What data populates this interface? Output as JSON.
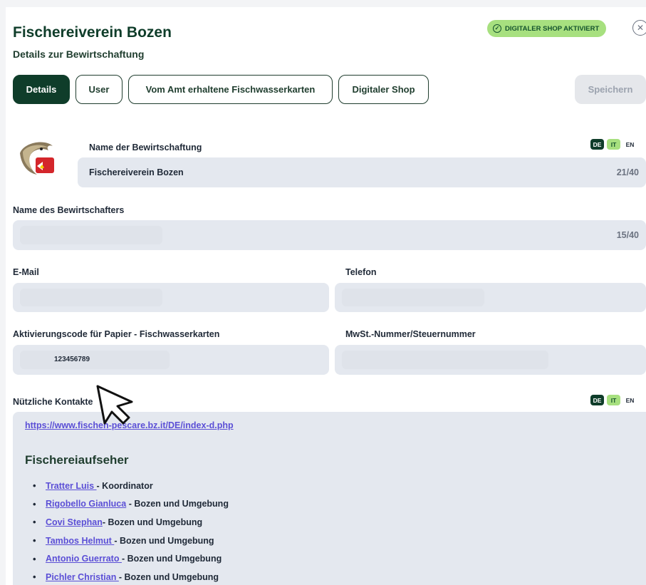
{
  "header": {
    "title": "Fischereiverein Bozen",
    "subtitle": "Details zur Bewirtschaftung",
    "shop_badge": "DIGITALER SHOP AKTIVIERT",
    "close_symbol": "✕"
  },
  "tabs": [
    {
      "label": "Details",
      "active": true
    },
    {
      "label": "User",
      "active": false
    },
    {
      "label": "Vom Amt erhaltene Fischwasserkarten",
      "active": false
    },
    {
      "label": "Digitaler Shop",
      "active": false
    }
  ],
  "save_label": "Speichern",
  "form": {
    "bewirtschaftung": {
      "label": "Name der Bewirtschaftung",
      "value": "Fischereiverein Bozen",
      "counter": "21/40"
    },
    "bewirtschafter": {
      "label": "Name des Bewirtschafters",
      "value": "",
      "counter": "15/40"
    },
    "email": {
      "label": "E-Mail",
      "value": ""
    },
    "telefon": {
      "label": "Telefon",
      "value": ""
    },
    "aktivierungscode": {
      "label": "Aktivierungscode für Papier - Fischwasserkarten",
      "value": "123456789"
    },
    "mwst": {
      "label": "MwSt.-Nummer/Steuernummer",
      "value": ""
    },
    "kontakte_label": "Nützliche Kontakte"
  },
  "languages": [
    "DE",
    "IT",
    "EN"
  ],
  "contacts": {
    "link": "https://www.fischen-pescare.bz.it/DE/index-d.php",
    "heading": "Fischereiaufseher",
    "items": [
      {
        "name": "Tratter Luis ",
        "role": "- Koordinator"
      },
      {
        "name": "Rigobello Gianluca",
        "role": " - Bozen und Umgebung"
      },
      {
        "name": "Covi Stephan",
        "role": "- Bozen und Umgebung"
      },
      {
        "name": "Tambos Helmut ",
        "role": "- Bozen und Umgebung"
      },
      {
        "name": "Antonio Guerrato ",
        "role": "- Bozen und Umgebung"
      },
      {
        "name": "Pichler Christian ",
        "role": "- Bozen und Umgebung"
      }
    ]
  },
  "colors": {
    "primary": "#0f3d2a",
    "accent": "#a7e07f",
    "field_bg": "#e4e8ef",
    "link": "#5b4fd6"
  }
}
